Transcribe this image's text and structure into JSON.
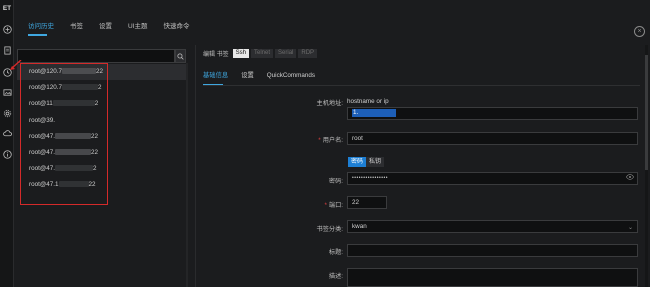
{
  "rail": {
    "logo": "ET",
    "icons": [
      "plus-icon",
      "document-icon",
      "clock-icon",
      "image-icon",
      "gear-icon",
      "cloud-icon",
      "info-icon"
    ]
  },
  "topnav": {
    "tabs": [
      {
        "label": "访问历史",
        "active": true
      },
      {
        "label": "书签",
        "active": false
      },
      {
        "label": "设置",
        "active": false
      },
      {
        "label": "UI主题",
        "active": false
      },
      {
        "label": "快速命令",
        "active": false
      }
    ],
    "close": "×"
  },
  "search": {
    "placeholder": "",
    "button_icon": "search-icon"
  },
  "hosts": [
    {
      "prefix": "root@120.7",
      "suffix": "22",
      "selected": true
    },
    {
      "prefix": "root@120.7",
      "suffix": "2",
      "selected": false
    },
    {
      "prefix": "root@11",
      "suffix": "2",
      "selected": false
    },
    {
      "prefix": "root@39.",
      "suffix": "",
      "selected": false
    },
    {
      "prefix": "root@47.",
      "suffix": "22",
      "selected": false
    },
    {
      "prefix": "root@47.",
      "suffix": "22",
      "selected": false
    },
    {
      "prefix": "root@47.",
      "suffix": "2",
      "selected": false
    },
    {
      "prefix": "root@47.1",
      "suffix": "22",
      "selected": false
    }
  ],
  "modebar": {
    "label": "编辑 书签",
    "buttons": [
      {
        "label": "Ssh",
        "on": true
      },
      {
        "label": "Telnet",
        "on": false
      },
      {
        "label": "Serial",
        "on": false
      },
      {
        "label": "RDP",
        "on": false
      }
    ]
  },
  "subtabs": [
    {
      "label": "基础信息",
      "active": true
    },
    {
      "label": "设置",
      "active": false
    },
    {
      "label": "QuickCommands",
      "active": false
    }
  ],
  "form": {
    "host_label": "主机地址:",
    "host_hint": "hostname or ip",
    "host_value": "1.",
    "user_label": "用户名:",
    "user_value": "root",
    "auth_tabs": [
      {
        "label": "密码",
        "on": true
      },
      {
        "label": "私钥",
        "on": false
      }
    ],
    "password_label": "密码:",
    "password_value": "••••••••••••••••",
    "port_label": "端口:",
    "port_value": "22",
    "category_label": "书签分类:",
    "category_value": "kwan",
    "title_label": "标题:",
    "title_value": "",
    "desc_label": "描述:",
    "desc_value": ""
  },
  "colors": {
    "accent": "#3fa7e0",
    "highlight": "#d42a2a",
    "background": "#1b1c1e"
  }
}
